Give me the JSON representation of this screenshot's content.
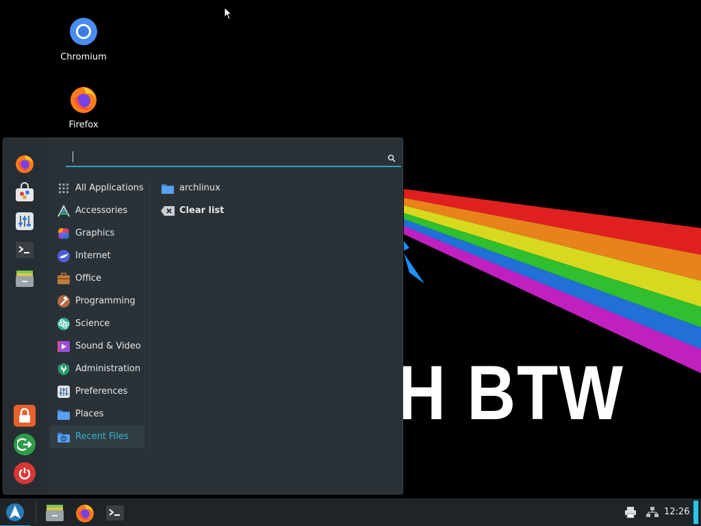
{
  "desktop": {
    "icons": [
      {
        "label": "Chromium",
        "icon": "chromium-icon"
      },
      {
        "label": "Firefox",
        "icon": "firefox-icon"
      }
    ],
    "wallpaper_text": "H BTW"
  },
  "menu": {
    "search": {
      "value": "",
      "placeholder": ""
    },
    "favorites": [
      "firefox-icon",
      "software-store-icon",
      "settings-icon",
      "terminal-icon",
      "file-manager-icon"
    ],
    "session": [
      "lock-icon",
      "logout-icon",
      "power-icon"
    ],
    "categories": [
      {
        "label": "All Applications",
        "icon": "grid-icon"
      },
      {
        "label": "Accessories",
        "icon": "accessories-icon"
      },
      {
        "label": "Graphics",
        "icon": "graphics-icon"
      },
      {
        "label": "Internet",
        "icon": "internet-icon"
      },
      {
        "label": "Office",
        "icon": "office-icon"
      },
      {
        "label": "Programming",
        "icon": "programming-icon"
      },
      {
        "label": "Science",
        "icon": "science-icon"
      },
      {
        "label": "Sound & Video",
        "icon": "sound-video-icon"
      },
      {
        "label": "Administration",
        "icon": "administration-icon"
      },
      {
        "label": "Preferences",
        "icon": "preferences-icon"
      },
      {
        "label": "Places",
        "icon": "folder-icon"
      },
      {
        "label": "Recent Files",
        "icon": "recent-files-icon"
      }
    ],
    "selected_category": "Recent Files",
    "recent_files": [
      {
        "label": "archlinux",
        "icon": "folder-icon"
      },
      {
        "label": "Clear list",
        "icon": "clear-icon"
      }
    ]
  },
  "taskbar": {
    "apps": [
      "file-manager-icon",
      "firefox-icon",
      "terminal-icon"
    ],
    "clock": "12:26"
  },
  "colors": {
    "accent": "#25a8c6",
    "menu_bg": "#2a3238",
    "taskbar_bg": "#1e2428"
  }
}
